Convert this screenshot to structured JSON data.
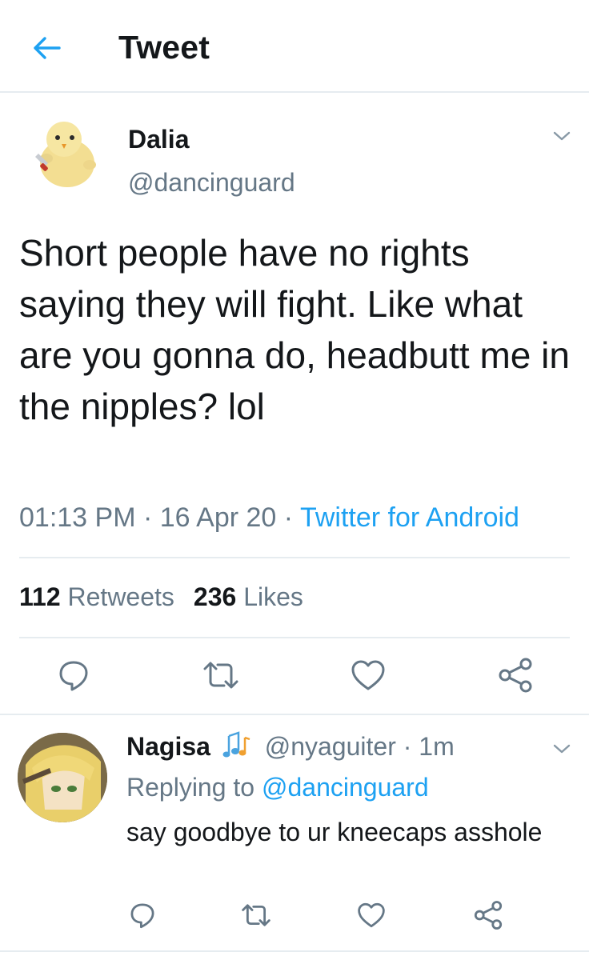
{
  "header": {
    "title": "Tweet",
    "back_icon": "arrow-left-icon",
    "accent": "#1da1f2"
  },
  "tweet": {
    "author_name": "Dalia",
    "author_handle": "@dancinguard",
    "text": "Short people have no rights saying they will fight. Like what are you gonna do, headbutt me in the nipples? lol",
    "time": "01:13 PM",
    "sep1": "·",
    "date": "16 Apr 20",
    "sep2": "·",
    "source": "Twitter for Android",
    "retweets_count": "112",
    "retweets_label": "Retweets",
    "likes_count": "236",
    "likes_label": "Likes"
  },
  "reply": {
    "author_name": "Nagisa",
    "author_handle": "@nyaguiter",
    "sep": "·",
    "time": "1m",
    "replying_prefix": "Replying to",
    "replying_to": "@dancinguard",
    "text": "say goodbye to ur kneecaps asshole"
  },
  "colors": {
    "text": "#14171a",
    "secondary": "#657786",
    "link": "#1da1f2",
    "divider": "#e6ecf0"
  },
  "icons": [
    "arrow-left-icon",
    "chevron-down-icon",
    "reply-icon",
    "retweet-icon",
    "heart-icon",
    "share-icon",
    "music-notes-icon"
  ]
}
